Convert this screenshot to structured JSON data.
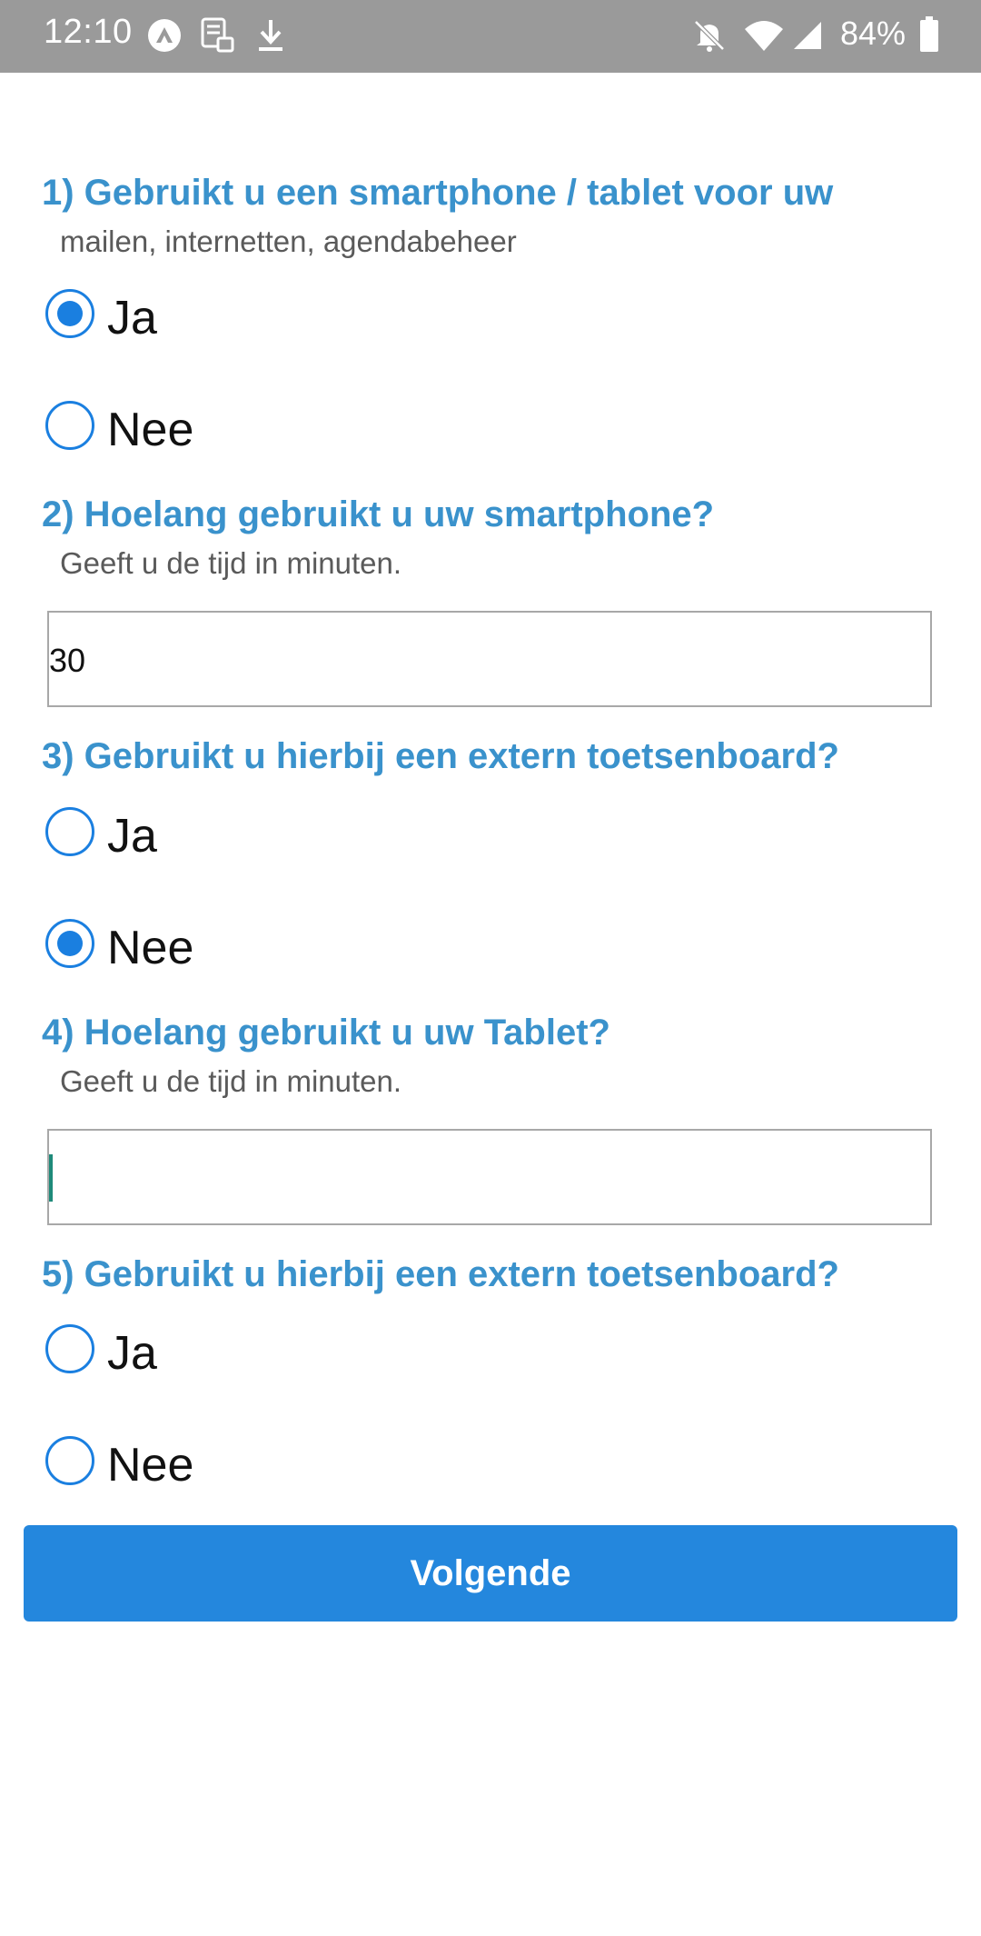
{
  "status_bar": {
    "time": "12:10",
    "battery": "84%",
    "icons": [
      "app-icon",
      "sim-icon",
      "download-icon",
      "mute-icon",
      "wifi-icon",
      "signal-icon",
      "battery-icon"
    ]
  },
  "colors": {
    "accent": "#3a92cc",
    "radio": "#1a7fe0",
    "button": "#2487dd"
  },
  "questions": [
    {
      "title": "1) Gebruikt u een smartphone / tablet voor uw",
      "subtitle": "mailen, internetten, agendabeheer",
      "options": [
        {
          "label": "Ja",
          "checked": true
        },
        {
          "label": "Nee",
          "checked": false
        }
      ]
    },
    {
      "title": "2) Hoelang gebruikt u uw smartphone?",
      "subtitle": "Geeft u de tijd in minuten.",
      "input_value": "30"
    },
    {
      "title": "3) Gebruikt u hierbij een extern toetsenboard?",
      "options": [
        {
          "label": "Ja",
          "checked": false
        },
        {
          "label": "Nee",
          "checked": true
        }
      ]
    },
    {
      "title": "4) Hoelang gebruikt u uw Tablet?",
      "subtitle": "Geeft u de tijd in minuten.",
      "input_value": ""
    },
    {
      "title": "5) Gebruikt u hierbij een extern toetsenboard?",
      "options": [
        {
          "label": "Ja",
          "checked": false
        },
        {
          "label": "Nee",
          "checked": false
        }
      ]
    }
  ],
  "next_button": "Volgende"
}
